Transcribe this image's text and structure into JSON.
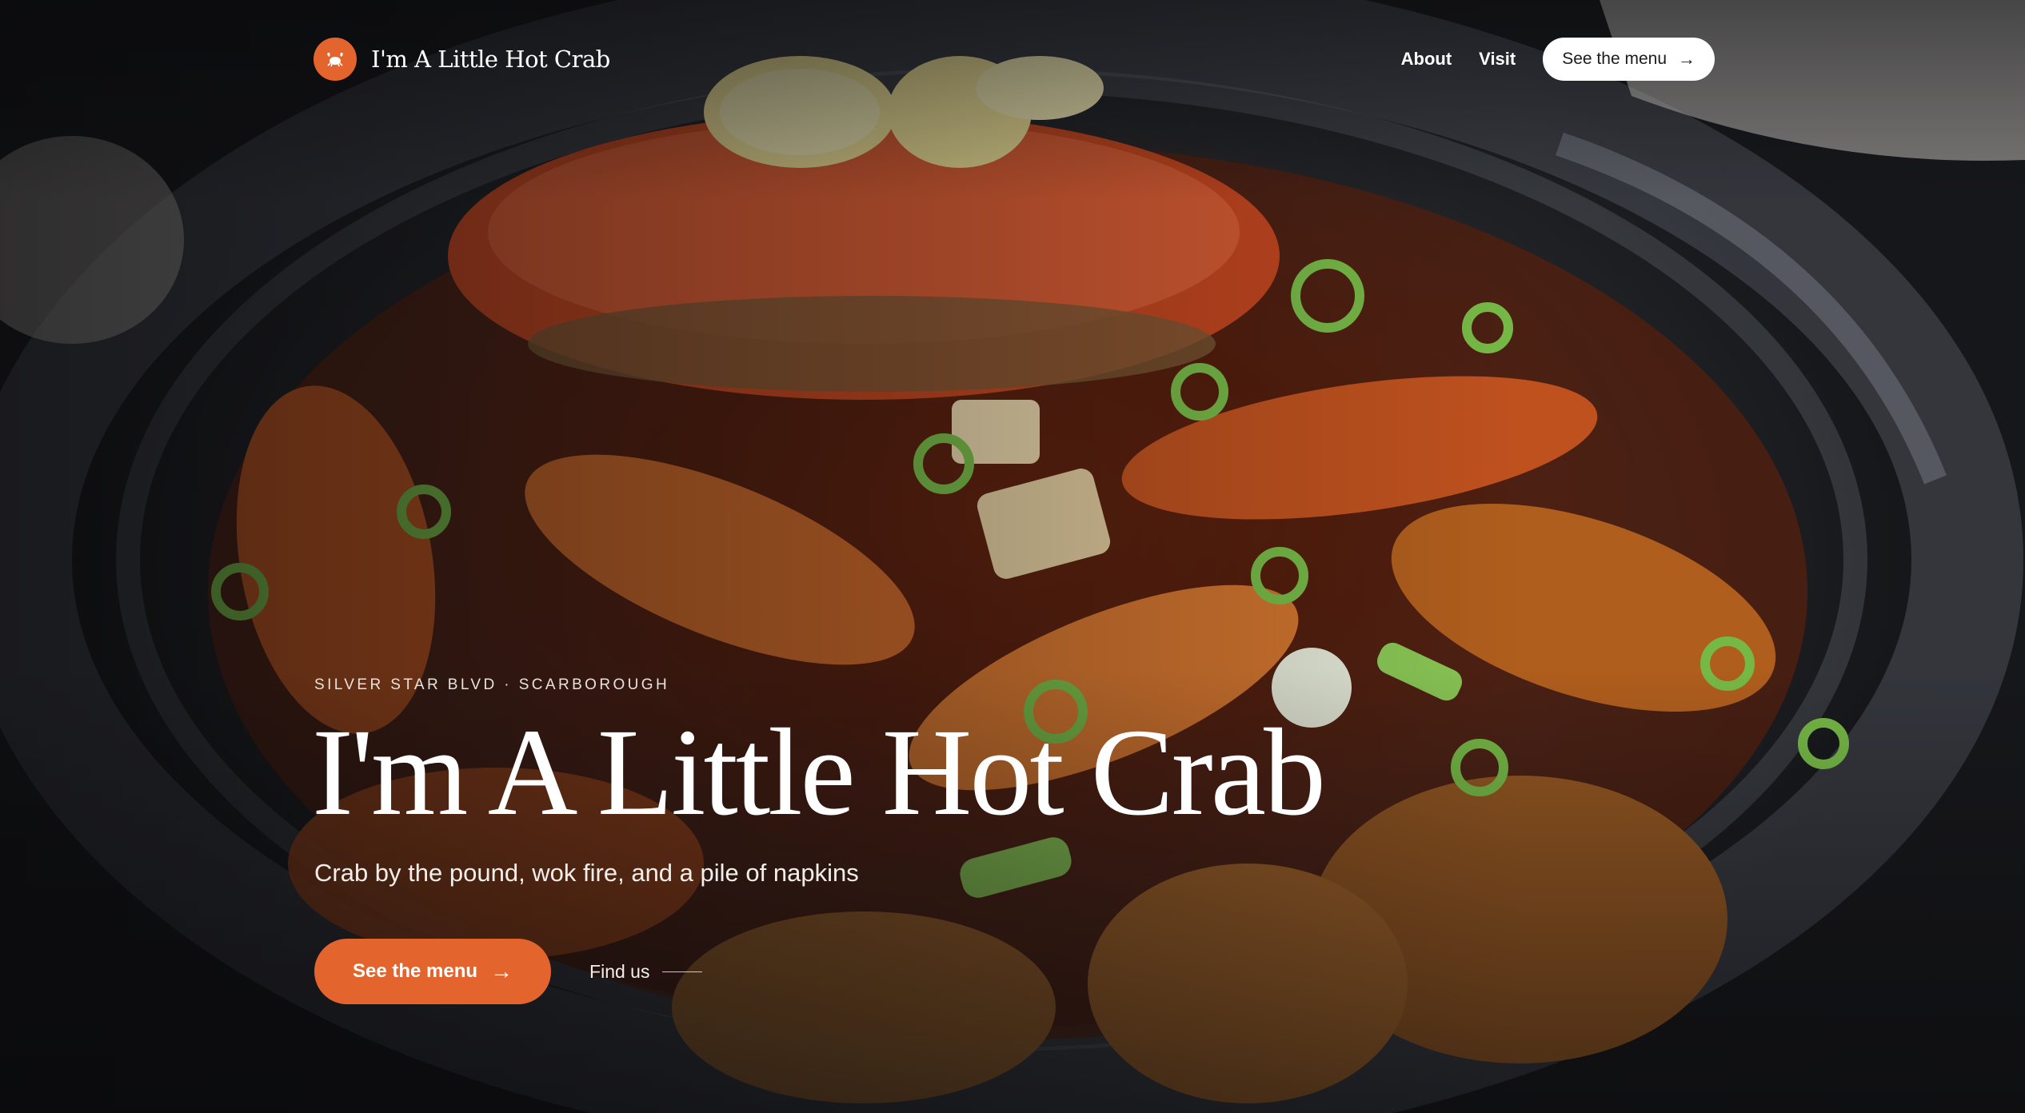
{
  "nav": {
    "brand_name": "I'm A Little Hot Crab",
    "logo_icon": "crab-icon",
    "links": [
      {
        "label": "About"
      },
      {
        "label": "Visit"
      }
    ],
    "cta_label": "See the menu",
    "cta_icon": "arrow-right-icon"
  },
  "hero": {
    "eyebrow": "SILVER STAR BLVD · SCARBOROUGH",
    "title": "I'm A Little Hot Crab",
    "subtitle": "Crab by the pound, wok fire, and a pile of napkins",
    "primary_cta": "See the menu",
    "primary_cta_arrow": "→",
    "secondary_cta": "Find us"
  },
  "colors": {
    "accent": "#e4642d",
    "text": "#ffffff",
    "nav_cta_bg": "#ffffff",
    "nav_cta_text": "#1b1b1b"
  }
}
